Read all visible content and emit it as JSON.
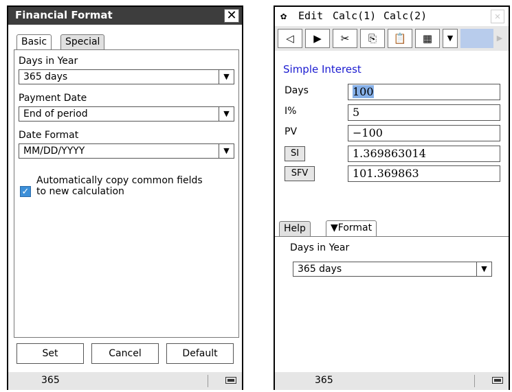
{
  "left": {
    "title": "Financial Format",
    "close": "✕",
    "tabs": [
      "Basic",
      "Special"
    ],
    "days_label": "Days in Year",
    "days_value": "365 days",
    "payment_label": "Payment Date",
    "payment_value": "End of period",
    "date_label": "Date Format",
    "date_value": "MM/DD/YYYY",
    "checkbox_checked": true,
    "checkbox_line1": "Automatically copy common fields",
    "checkbox_line2": "to new calculation",
    "buttons": {
      "set": "Set",
      "cancel": "Cancel",
      "default": "Default"
    },
    "status": "365"
  },
  "right": {
    "menu": {
      "edit": "Edit",
      "calc1": "Calc(1)",
      "calc2": "Calc(2)"
    },
    "heading": "Simple Interest",
    "rows": {
      "days": {
        "label": "Days",
        "value": "100"
      },
      "ipct": {
        "label": "I%",
        "value": "5"
      },
      "pv": {
        "label": "PV",
        "value": "−100"
      },
      "si": {
        "label": "SI",
        "value": "1.369863014"
      },
      "sfv": {
        "label": "SFV",
        "value": "101.369863"
      }
    },
    "tabs": {
      "help": "Help",
      "format": "▼Format"
    },
    "days_label": "Days in Year",
    "days_value": "365 days",
    "status": "365"
  },
  "colors": {
    "title_bar": "#3d3d3d",
    "accent_blue": "#1a1ad0",
    "checkbox": "#3c8fd8",
    "selection": "#86b0e8"
  }
}
